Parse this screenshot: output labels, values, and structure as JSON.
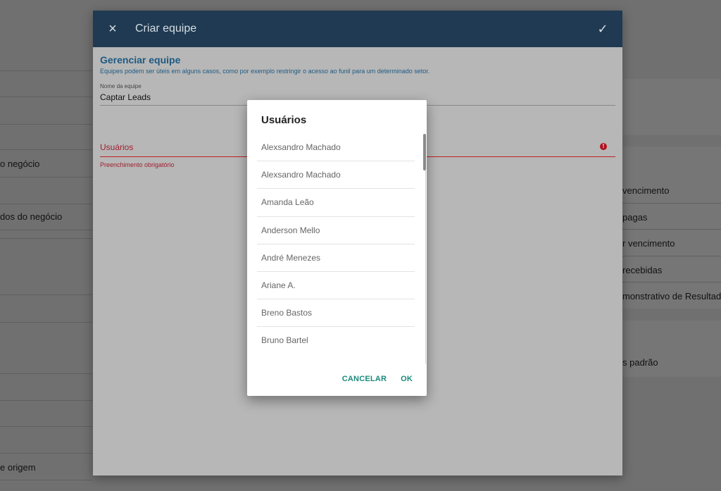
{
  "background": {
    "left_items": [
      "o negócio",
      "dos do negócio",
      "e origem"
    ],
    "right_items": [
      "vencimento",
      "pagas",
      "r vencimento",
      "recebidas",
      "monstrativo de Resultado",
      "s padrão"
    ]
  },
  "modal": {
    "title": "Criar equipe",
    "close_icon": "×",
    "confirm_icon": "✓",
    "section_title": "Gerenciar equipe",
    "section_desc": "Equipes podem ser úteis em alguns casos, como por exemplo restringir o acesso ao funil para um determinado setor.",
    "team_name_label": "Nome da equipe",
    "team_name_value": "Captar Leads",
    "users_label": "Usuários",
    "required_msg": "Preenchimento obrigatório"
  },
  "dialog": {
    "title": "Usuários",
    "users": [
      "Alexsandro Machado",
      "Alexsandro Machado",
      "Amanda Leão",
      "Anderson Mello",
      "André Menezes",
      "Ariane A.",
      "Breno Bastos",
      "Bruno Bartel"
    ],
    "cancel_label": "CANCELAR",
    "ok_label": "OK"
  },
  "colors": {
    "header_bg": "#1f3a52",
    "accent_teal": "#1a8a7a",
    "error_red": "#a01f2f",
    "section_blue": "#1e5a82"
  }
}
